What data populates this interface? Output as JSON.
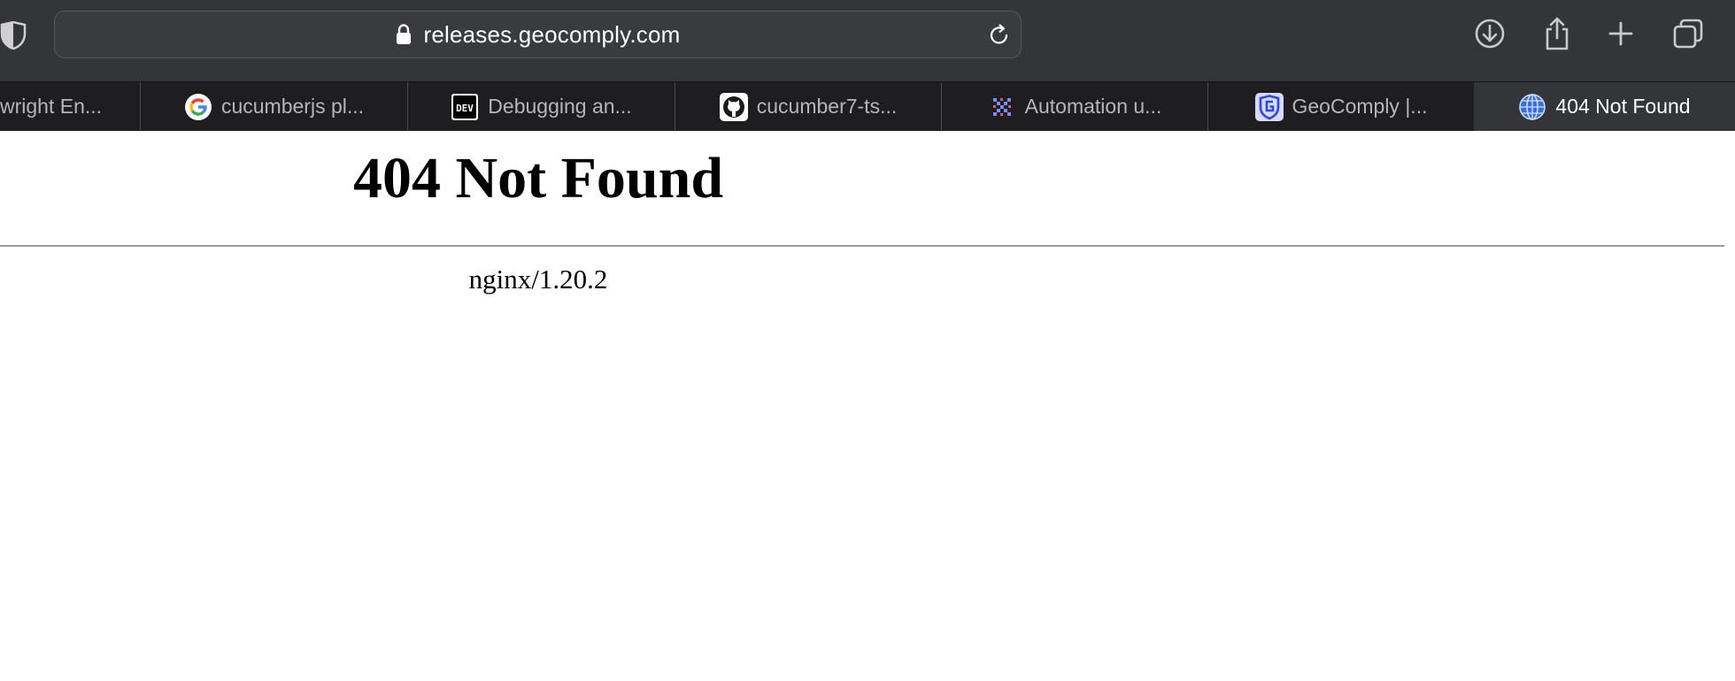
{
  "browser": {
    "url": "releases.geocomply.com",
    "icons": [
      "shield-icon",
      "lock-icon",
      "reload-icon",
      "download-icon",
      "share-icon",
      "new-tab-icon",
      "tab-overview-icon"
    ],
    "tabs": [
      {
        "title": "wright En...",
        "favicon": "none",
        "active": false
      },
      {
        "title": "cucumberjs pl...",
        "favicon": "google-icon",
        "active": false
      },
      {
        "title": "Debugging an...",
        "favicon": "dev-icon",
        "active": false
      },
      {
        "title": "cucumber7-ts...",
        "favicon": "github-icon",
        "active": false
      },
      {
        "title": "Automation u...",
        "favicon": "automation-icon",
        "active": false
      },
      {
        "title": "GeoComply |...",
        "favicon": "geocomply-icon",
        "active": false
      },
      {
        "title": "404 Not Found",
        "favicon": "globe-icon",
        "active": true
      }
    ],
    "colors": {
      "toolbar": "#343538",
      "tabstrip": "#1e1e20",
      "active_tab": "#343538"
    }
  },
  "page": {
    "heading": "404 Not Found",
    "server": "nginx/1.20.2"
  }
}
